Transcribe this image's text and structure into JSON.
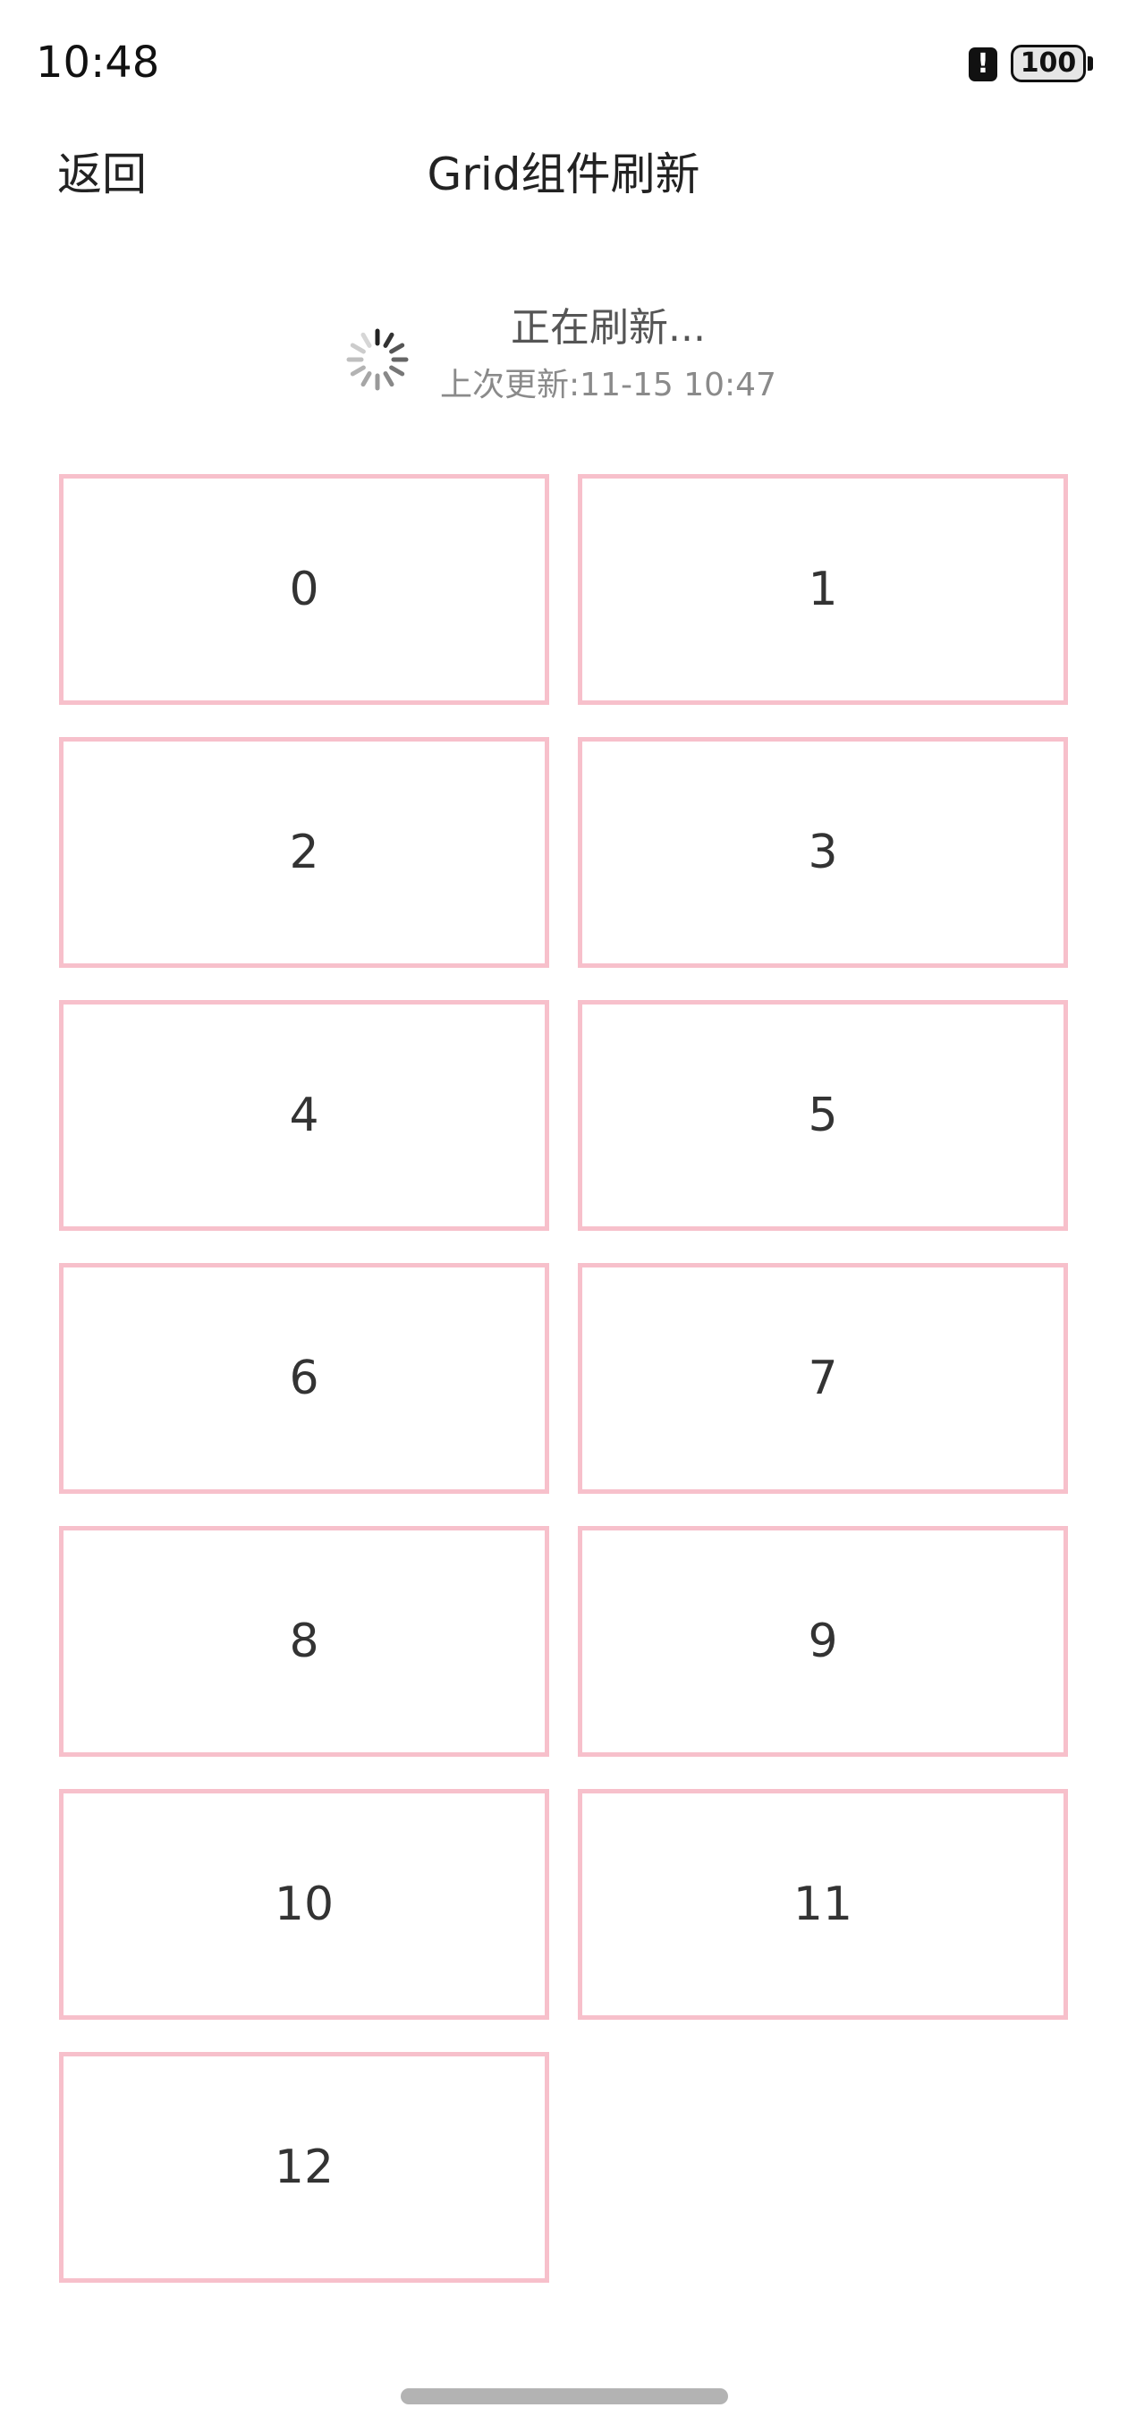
{
  "status_bar": {
    "time": "10:48",
    "alert_icon": "!",
    "battery_level": "100"
  },
  "header": {
    "back_label": "返回",
    "title": "Grid组件刷新"
  },
  "refresh": {
    "status_text": "正在刷新...",
    "last_update": "上次更新:11-15 10:47"
  },
  "grid": {
    "items": [
      "0",
      "1",
      "2",
      "3",
      "4",
      "5",
      "6",
      "7",
      "8",
      "9",
      "10",
      "11",
      "12"
    ],
    "border_color": "#f7c0cb"
  }
}
